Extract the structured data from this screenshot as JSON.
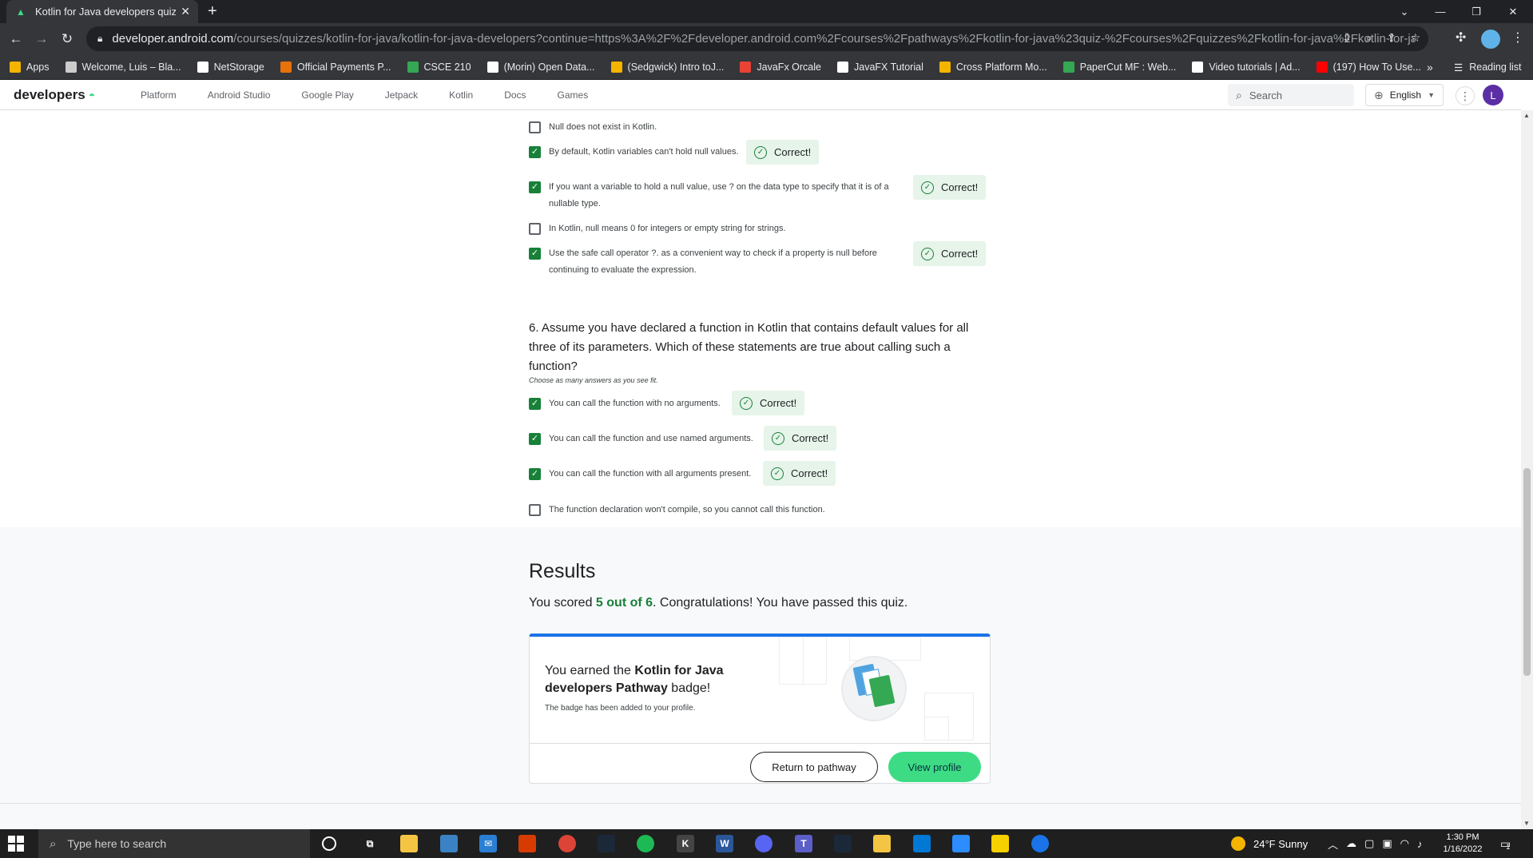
{
  "browser": {
    "tab_title": "Kotlin for Java developers quiz |",
    "url_host": "developer.android.com",
    "url_path": "/courses/quizzes/kotlin-for-java/kotlin-for-java-developers?continue=https%3A%2F%2Fdeveloper.android.com%2Fcourses%2Fpathways%2Fkotlin-for-java%23quiz-%2Fcourses%2Fquizzes%2Fkotlin-for-java%2Fkotlin-for-java...",
    "bookmarks": [
      {
        "label": "Apps",
        "color": "#f4b400"
      },
      {
        "label": "Welcome, Luis – Bla...",
        "color": "#cccccc"
      },
      {
        "label": "NetStorage",
        "color": "#ffffff"
      },
      {
        "label": "Official Payments P...",
        "color": "#e8710a"
      },
      {
        "label": "CSCE 210",
        "color": "#34a853"
      },
      {
        "label": "(Morin) Open Data...",
        "color": "#ffffff"
      },
      {
        "label": "(Sedgwick) Intro toJ...",
        "color": "#f4b400"
      },
      {
        "label": "JavaFx Orcale",
        "color": "#ea4335"
      },
      {
        "label": "JavaFX Tutorial",
        "color": "#ffffff"
      },
      {
        "label": "Cross Platform Mo...",
        "color": "#f4b400"
      },
      {
        "label": "PaperCut MF : Web...",
        "color": "#34a853"
      },
      {
        "label": "Video tutorials | Ad...",
        "color": "#ffffff"
      },
      {
        "label": "(197) How To Use...",
        "color": "#ff0000"
      }
    ],
    "reading_list": "Reading list"
  },
  "site": {
    "logo": "developers",
    "nav": [
      "Platform",
      "Android Studio",
      "Google Play",
      "Jetpack",
      "Kotlin",
      "Docs",
      "Games"
    ],
    "search_placeholder": "Search",
    "language": "English",
    "avatar_letter": "L"
  },
  "quiz": {
    "q5_options": [
      {
        "text": "Null does not exist in Kotlin.",
        "checked": false
      },
      {
        "text": "By default, Kotlin variables can't hold null values.",
        "checked": true
      },
      {
        "text": "If you want a variable to hold a null value, use ? on the data type to specify that it is of a",
        "text2": "nullable type.",
        "checked": true
      },
      {
        "text": "In Kotlin, null means 0 for integers or empty string for strings.",
        "checked": false
      },
      {
        "text": "Use the safe call operator ?. as a convenient way to check if a property is null before",
        "text2": "continuing to evaluate the expression.",
        "checked": true
      }
    ],
    "correct_label": "Correct!",
    "q6_question": "6. Assume you have declared a function in Kotlin that contains default values for all three of its parameters. Which of these statements are true about calling such a function?",
    "q6_hint": "Choose as many answers as you see fit.",
    "q6_options": [
      {
        "text": "You can call the function with no arguments.",
        "checked": true
      },
      {
        "text": "You can call the function and use named arguments.",
        "checked": true
      },
      {
        "text": "You can call the function with all arguments present.",
        "checked": true
      },
      {
        "text": "The function declaration won't compile, so you cannot call this function.",
        "checked": false
      }
    ]
  },
  "results": {
    "title": "Results",
    "score_prefix": "You scored ",
    "score": "5 out of 6",
    "score_suffix": ". Congratulations! You have passed this quiz.",
    "earned_prefix": "You earned the ",
    "badge_name": "Kotlin for Java developers Pathway",
    "earned_suffix": " badge!",
    "added": "The badge has been added to your profile.",
    "return_button": "Return to pathway",
    "view_button": "View profile"
  },
  "taskbar": {
    "search_placeholder": "Type here to search",
    "weather": "24°F  Sunny",
    "time": "1:30 PM",
    "date": "1/16/2022",
    "notification_count": "1"
  }
}
